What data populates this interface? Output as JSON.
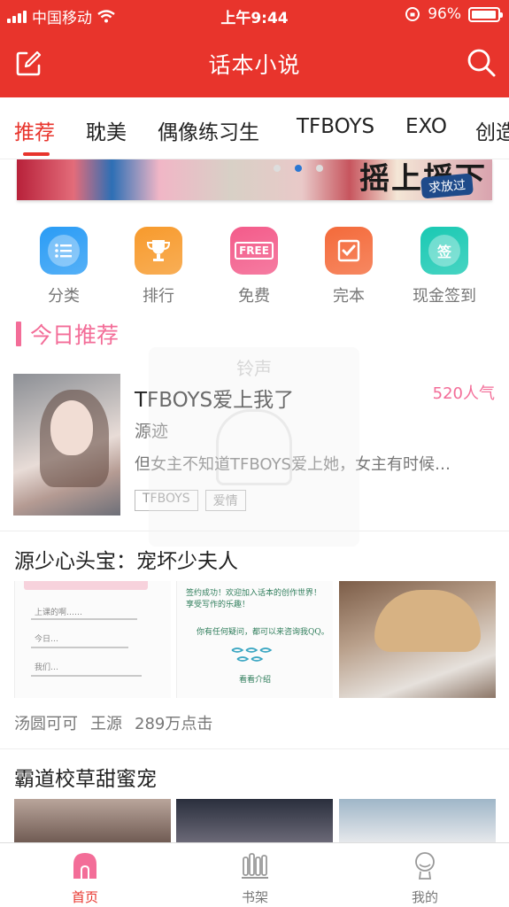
{
  "status_bar": {
    "carrier": "中国移动",
    "time": "上午9:44",
    "battery": "96%",
    "battery_level": 0.96
  },
  "header": {
    "title": "话本小说",
    "edit_icon": "edit-square-icon",
    "search_icon": "search-icon"
  },
  "colors": {
    "brand_red": "#e8342c",
    "accent_pink": "#f36d98"
  },
  "tabs": [
    {
      "label": "推荐",
      "active": true
    },
    {
      "label": "耽美",
      "active": false
    },
    {
      "label": "偶像练习生",
      "active": false
    },
    {
      "label": "TFBOYS",
      "active": false
    },
    {
      "label": "EXO",
      "active": false
    },
    {
      "label": "创造",
      "active": false
    }
  ],
  "banner": {
    "art_text": "摇上摇下",
    "stamp_text": "求放过"
  },
  "quick_links": [
    {
      "label": "分类",
      "icon": "list-icon",
      "color": "#2a9cf5"
    },
    {
      "label": "排行",
      "icon": "trophy-icon",
      "color": "#f79a2c"
    },
    {
      "label": "免费",
      "icon": "free-tag-icon",
      "color": "#f35b8a",
      "badge": "FREE"
    },
    {
      "label": "完本",
      "icon": "check-book-icon",
      "color": "#f46a3a"
    },
    {
      "label": "现金签到",
      "icon": "sign-in-icon",
      "color": "#19c9b3",
      "badge": "签"
    }
  ],
  "section": {
    "title": "今日推荐"
  },
  "featured_book": {
    "title": "TFBOYS爱上我了",
    "popularity": "520人气",
    "author": "源迹",
    "description": "但女主不知道TFBOYS爱上她，女主有时候…",
    "tags": [
      "TFBOYS",
      "爱情"
    ]
  },
  "overlay": {
    "text": "铃声"
  },
  "block2": {
    "title": "源少心头宝：宠坏少夫人",
    "note1_lines": [
      "上课的啊……",
      "今日…",
      "我们…"
    ],
    "note2_lines": [
      "签约成功！欢迎加入话本的创作世界！享受写作的乐趣！",
      "你有任何疑问，都可以来咨询我QQ。",
      "看看介绍"
    ],
    "author1": "汤圆可可",
    "author2": "王源",
    "clicks": "289万点击"
  },
  "block3": {
    "title": "霸道校草甜蜜宠"
  },
  "bottom_nav": [
    {
      "label": "首页",
      "icon": "home-icon",
      "active": true
    },
    {
      "label": "书架",
      "icon": "bookshelf-icon",
      "active": false
    },
    {
      "label": "我的",
      "icon": "profile-icon",
      "active": false
    }
  ]
}
